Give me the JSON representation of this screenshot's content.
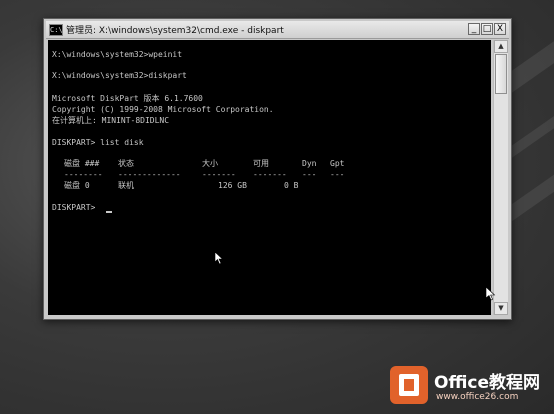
{
  "window": {
    "title": "管理员: X:\\windows\\system32\\cmd.exe - diskpart",
    "app_icon": "C:\\",
    "controls": {
      "minimize": "_",
      "maximize": "□",
      "close": "X"
    }
  },
  "console": {
    "lines": [
      "X:\\windows\\system32>wpeinit",
      "X:\\windows\\system32>diskpart",
      "Microsoft DiskPart 版本 6.1.7600",
      "Copyright (C) 1999-2008 Microsoft Corporation.",
      "在计算机上: MININT-8DIDLNC",
      "DISKPART> list disk",
      "DISKPART> "
    ],
    "table": {
      "headers": [
        "磁盘 ###",
        "状态",
        "大小",
        "可用",
        "Dyn",
        "Gpt"
      ],
      "separator": [
        "--------",
        "-------------",
        "-------",
        "-------",
        "---",
        "---"
      ],
      "rows": [
        [
          "磁盘 0",
          "联机",
          "126 GB",
          "0 B",
          "",
          ""
        ]
      ]
    }
  },
  "watermark": {
    "brand": "Office教程网",
    "sub": "www.office26.com"
  }
}
